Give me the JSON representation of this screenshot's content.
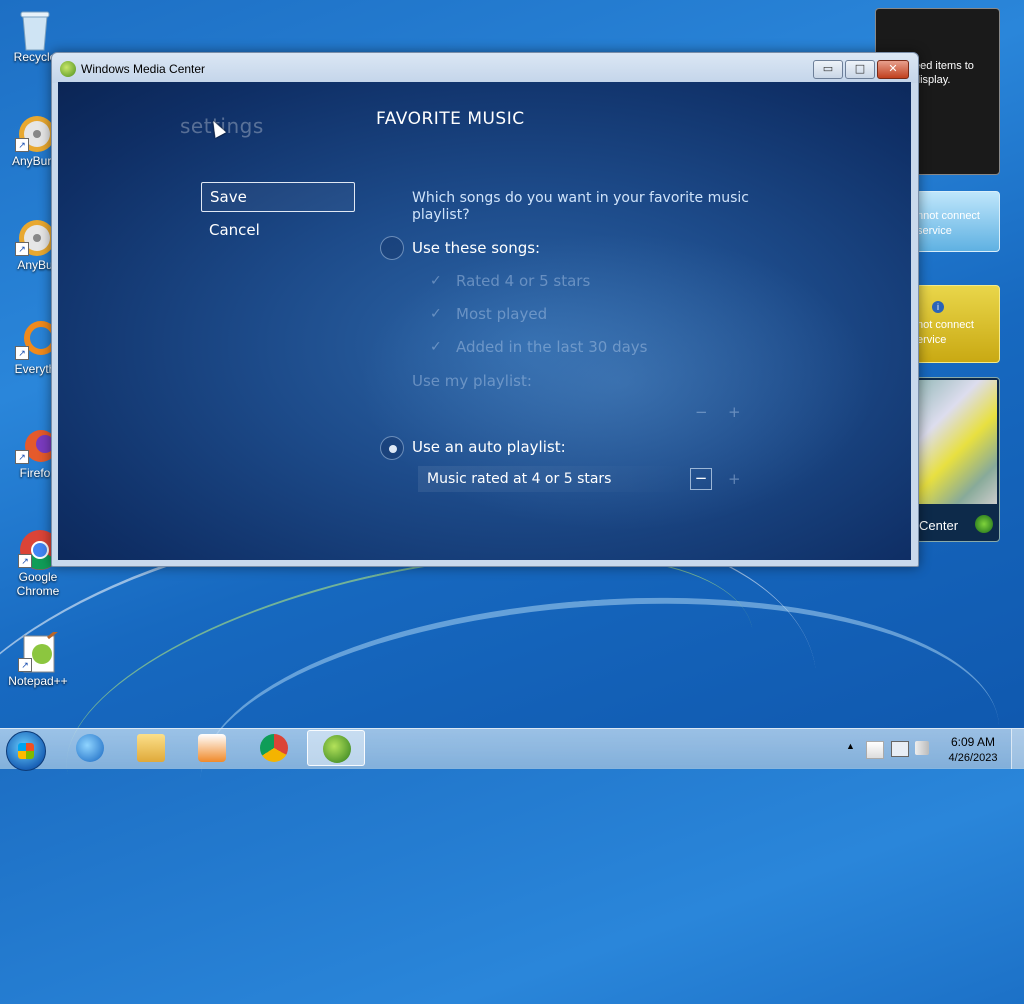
{
  "desktop": {
    "icons": [
      {
        "label": "Recycle",
        "icon": "recycle-bin-icon"
      },
      {
        "label": "AnyBurn",
        "icon": "anyburn-icon"
      },
      {
        "label": "AnyBu",
        "icon": "anyburn-icon"
      },
      {
        "label": "Everyth",
        "icon": "everything-icon"
      },
      {
        "label": "Firefo",
        "icon": "firefox-icon"
      },
      {
        "label": "Google Chrome",
        "icon": "chrome-icon"
      },
      {
        "label": "Notepad++",
        "icon": "notepadpp-icon"
      }
    ],
    "gadgets": {
      "feed_text": "eed items to display.",
      "weather_text": "nnot connect service",
      "currency_text": "not connect ervice",
      "mediacenter_text": "Center"
    }
  },
  "window": {
    "title": "Windows Media Center",
    "controls": {
      "minimize": "▭",
      "maximize": "□",
      "close": "✕"
    }
  },
  "media_center": {
    "section": "settings",
    "page_title": "FAVORITE MUSIC",
    "save_label": "Save",
    "cancel_label": "Cancel",
    "question": "Which songs do you want in your favorite music playlist?",
    "option_songs_label": "Use these songs:",
    "option_songs_selected": false,
    "song_criteria": [
      "Rated 4 or 5 stars",
      "Most played",
      "Added in the last 30 days"
    ],
    "playlist_label": "Use my playlist:",
    "option_auto_label": "Use an auto playlist:",
    "option_auto_selected": true,
    "auto_playlist_value": "Music rated at 4 or 5 stars",
    "minus_symbol": "−",
    "plus_symbol": "+",
    "check_symbol": "✓"
  },
  "taskbar": {
    "items": [
      "start-button",
      "internet-explorer",
      "windows-explorer",
      "media-player",
      "chrome",
      "media-center"
    ],
    "active_item": "media-center",
    "tray_arrow": "▲",
    "time": "6:09 AM",
    "date": "4/26/2023"
  }
}
